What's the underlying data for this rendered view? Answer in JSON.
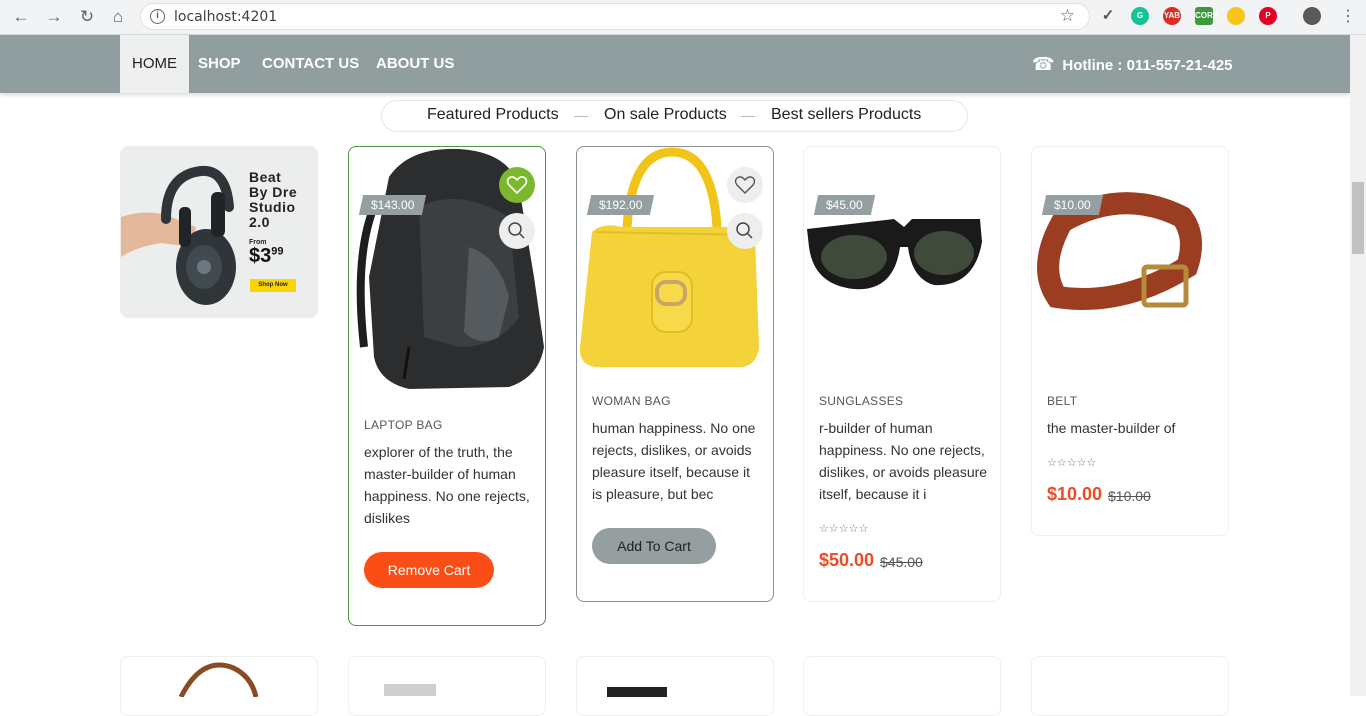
{
  "browser": {
    "url": "localhost:4201",
    "extensions": [
      "eyedropper-icon",
      "grammarly-icon",
      "yab-icon",
      "cors-icon",
      "moon-icon",
      "pinterest-icon",
      "profile-avatar"
    ],
    "ext_labels": {
      "yab": "YAB",
      "cors": "CORS"
    }
  },
  "nav": {
    "items": [
      "HOME",
      "SHOP",
      "CONTACT US",
      "ABOUT US"
    ],
    "hotline": "Hotline : 011-557-21-425"
  },
  "tabs": [
    "Featured Products",
    "On sale Products",
    "Best sellers Products"
  ],
  "banner": {
    "line1": "Beat",
    "line2": "By Dre",
    "line3": "Studio",
    "line4": "2.0",
    "from": "From",
    "price": "$3",
    "price_sup": "99",
    "cta": "Shop Now"
  },
  "products": [
    {
      "price_tag": "$143.00",
      "category": "LAPTOP BAG",
      "description": "explorer of the truth, the master-builder of human happiness. No one rejects, dislikes",
      "button": "Remove Cart"
    },
    {
      "price_tag": "$192.00",
      "category": "WOMAN BAG",
      "description": "human happiness. No one rejects, dislikes, or avoids pleasure itself, because it is pleasure, but bec",
      "button": "Add To Cart"
    },
    {
      "price_tag": "$45.00",
      "category": "SUNGLASSES",
      "description": "r-builder of human happiness. No one rejects, dislikes, or avoids pleasure itself, because it i",
      "rating": 0,
      "price": "$50.00",
      "old_price": "$45.00"
    },
    {
      "price_tag": "$10.00",
      "category": "BELT",
      "description": "the master-builder of",
      "rating": 0,
      "price": "$10.00",
      "old_price": "$10.00"
    }
  ],
  "colors": {
    "nav_bg": "#919ea0",
    "accent_orange": "#fb4e16",
    "price_red": "#ef4a23",
    "wishlist_green": "#7cb82f"
  }
}
